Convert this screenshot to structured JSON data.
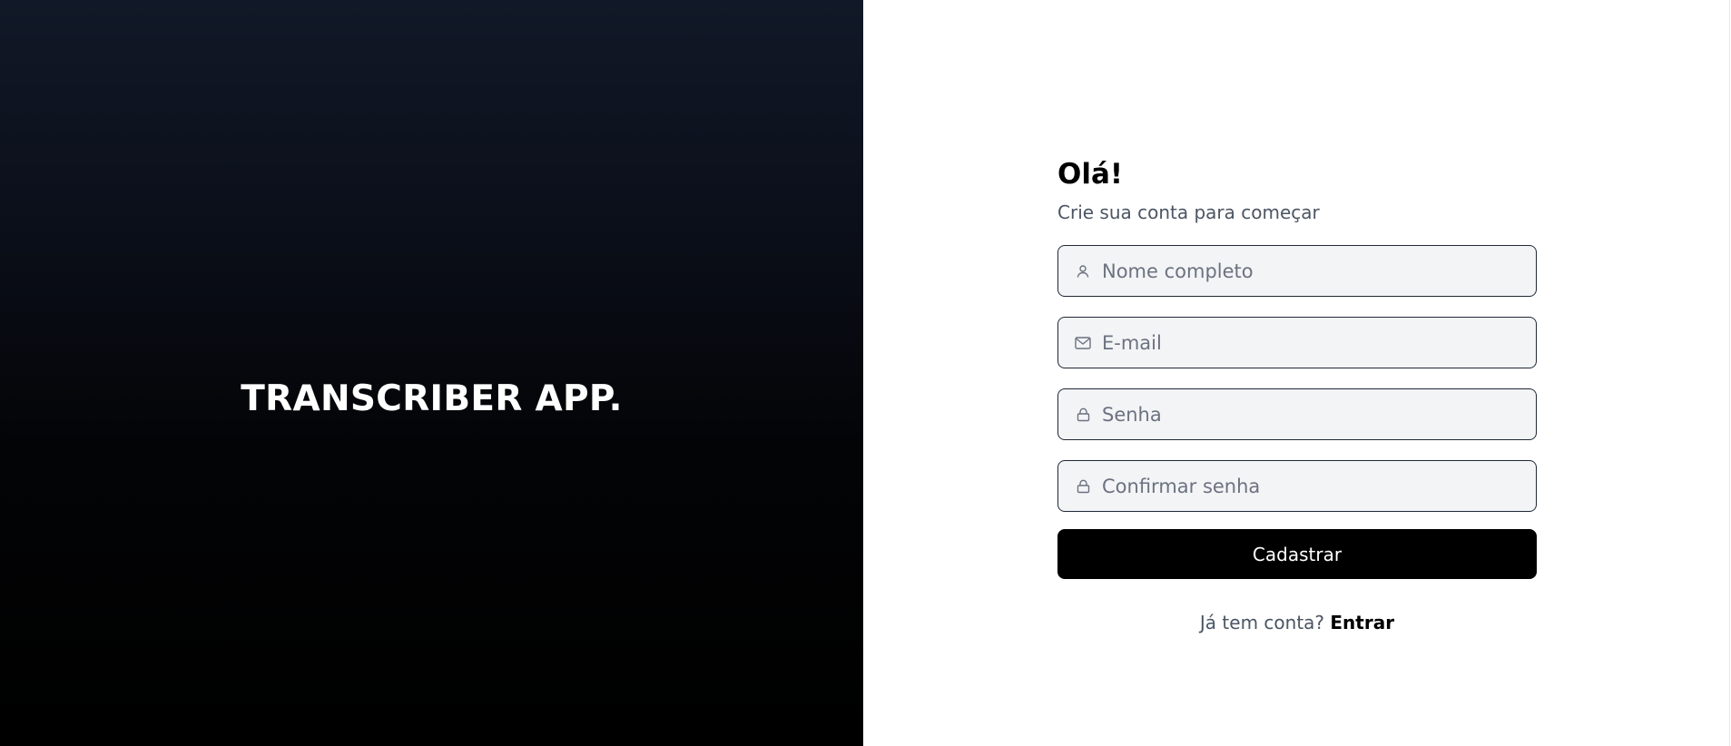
{
  "brand": {
    "title": "TRANSCRIBER APP."
  },
  "form": {
    "greeting": "Olá!",
    "subtitle": "Crie sua conta para começar",
    "fields": {
      "name": {
        "placeholder": "Nome completo",
        "value": "",
        "icon": "user-icon"
      },
      "email": {
        "placeholder": "E-mail",
        "value": "",
        "icon": "mail-icon"
      },
      "password": {
        "placeholder": "Senha",
        "value": "",
        "icon": "lock-icon"
      },
      "confirm_password": {
        "placeholder": "Confirmar senha",
        "value": "",
        "icon": "lock-icon"
      }
    },
    "submit_label": "Cadastrar",
    "login_prompt": "Já tem conta?",
    "login_link": "Entrar"
  },
  "colors": {
    "accent": "#000000",
    "field_bg": "#f3f4f6",
    "field_border": "#1f2937",
    "muted_text": "#4b5563"
  }
}
